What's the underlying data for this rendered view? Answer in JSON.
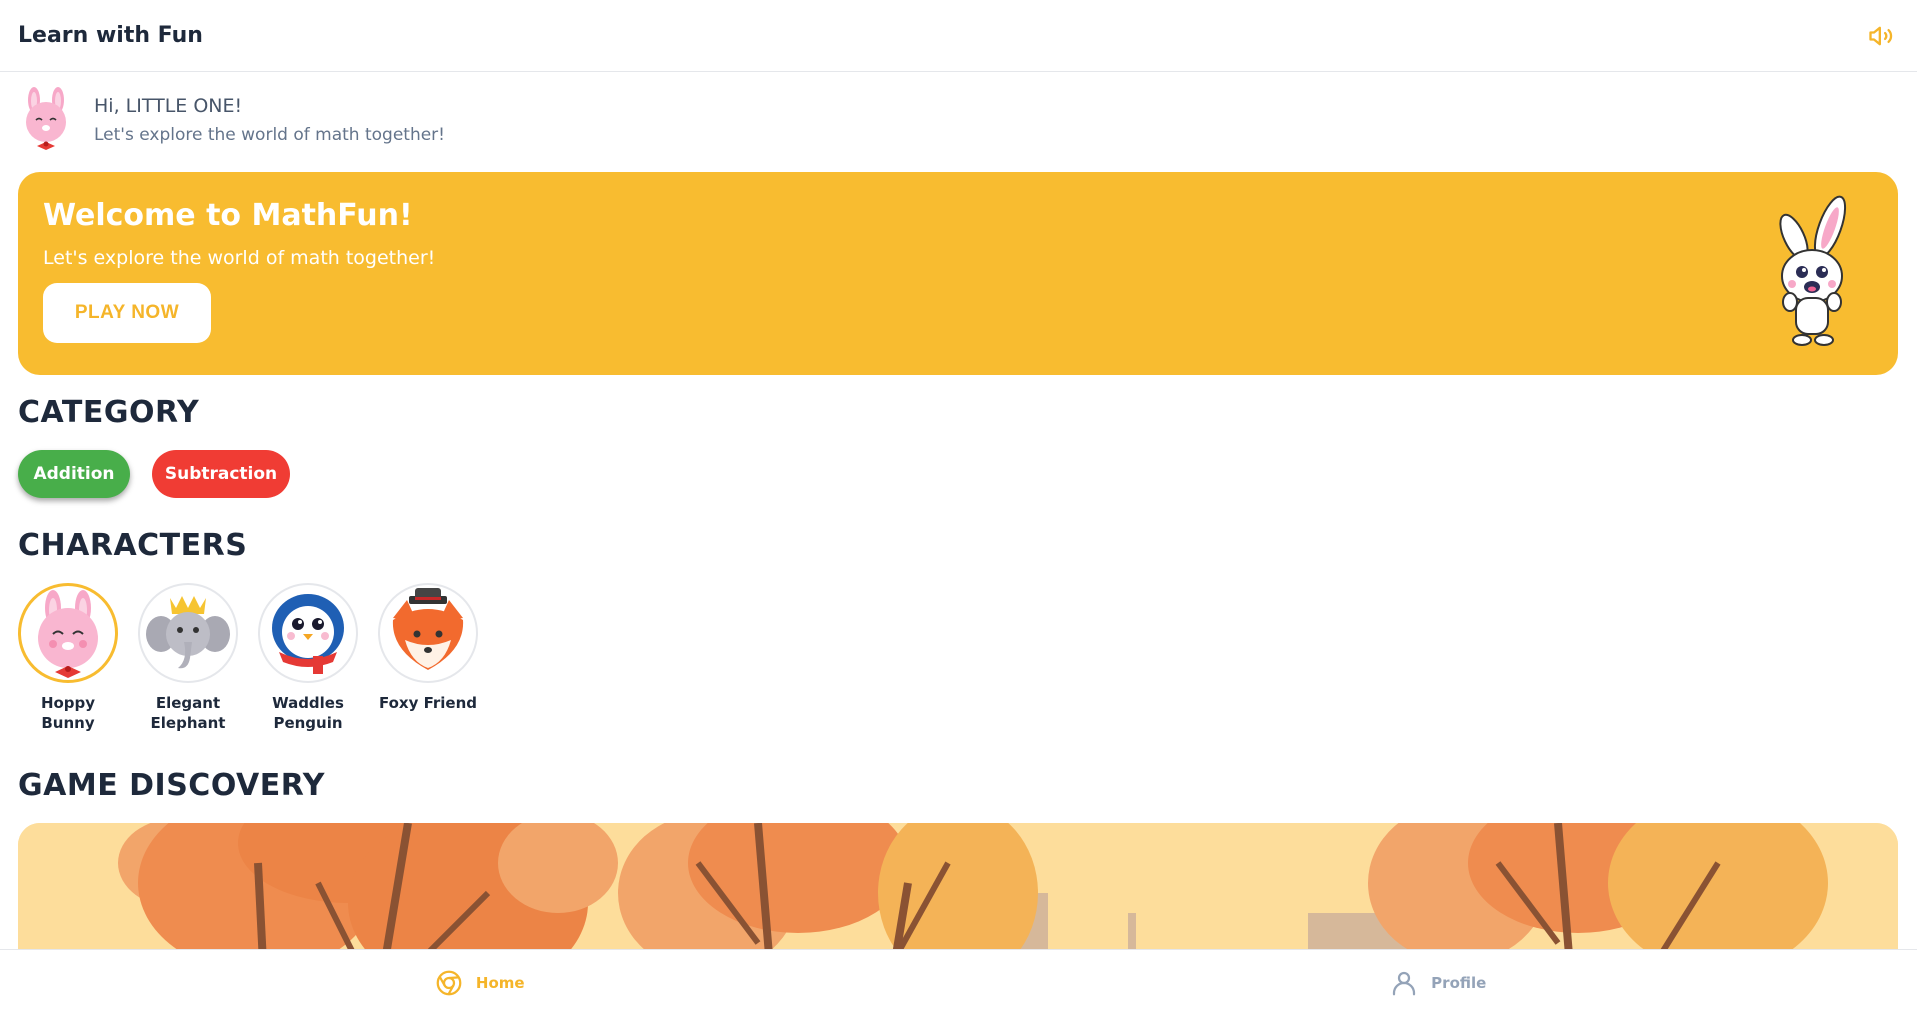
{
  "header": {
    "title": "Learn with Fun",
    "sound_icon": "speaker-volume-icon"
  },
  "greeting": {
    "hi": "Hi, LITTLE ONE!",
    "subtitle": "Let's explore the world of math together!"
  },
  "banner": {
    "title": "Welcome to MathFun!",
    "subtitle": "Let's explore the world of math together!",
    "button": "PLAY NOW",
    "color": "#f8bc30"
  },
  "category": {
    "title": "CATEGORY",
    "items": [
      {
        "label": "Addition",
        "color": "#48ae4a"
      },
      {
        "label": "Subtraction",
        "color": "#f03c34"
      }
    ]
  },
  "characters": {
    "title": "CHARACTERS",
    "items": [
      {
        "name": "Hoppy Bunny",
        "selected": true
      },
      {
        "name": "Elegant Elephant",
        "selected": false
      },
      {
        "name": "Waddles Penguin",
        "selected": false
      },
      {
        "name": "Foxy Friend",
        "selected": false
      }
    ]
  },
  "discovery": {
    "title": "GAME DISCOVERY"
  },
  "nav": {
    "items": [
      {
        "label": "Home",
        "icon": "home-icon",
        "active": true
      },
      {
        "label": "Profile",
        "icon": "user-icon",
        "active": false
      }
    ]
  },
  "colors": {
    "accent": "#f8bc30",
    "text": "#1e293b"
  }
}
